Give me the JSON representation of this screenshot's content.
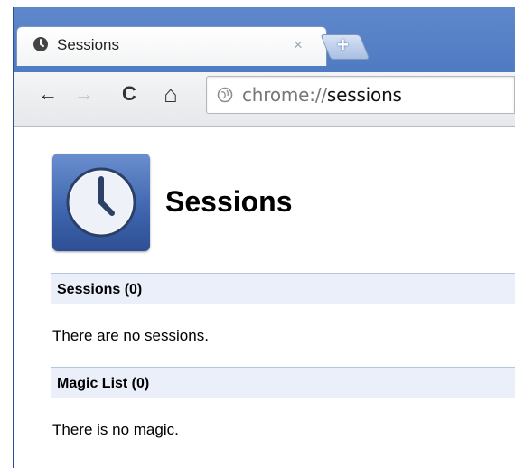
{
  "browser": {
    "tab": {
      "title": "Sessions",
      "close_glyph": "×",
      "icon": "clock-icon"
    },
    "new_tab_glyph": "+",
    "nav": {
      "back_glyph": "←",
      "forward_glyph": "→",
      "reload_glyph": "C",
      "home_glyph": "⌂"
    },
    "omnibox": {
      "scheme": "chrome://",
      "path": "sessions",
      "icon": "globe-icon"
    }
  },
  "page": {
    "icon": "clock-icon",
    "title": "Sessions",
    "sections": [
      {
        "header": "Sessions (0)",
        "empty_text": "There are no sessions."
      },
      {
        "header": "Magic List (0)",
        "empty_text": "There is no magic."
      }
    ]
  },
  "colors": {
    "titlebar": "#4f7bc3",
    "section_header_bg": "#ebeff9",
    "section_header_border": "#b5c7de",
    "icon_blue": "#3d64ad"
  }
}
